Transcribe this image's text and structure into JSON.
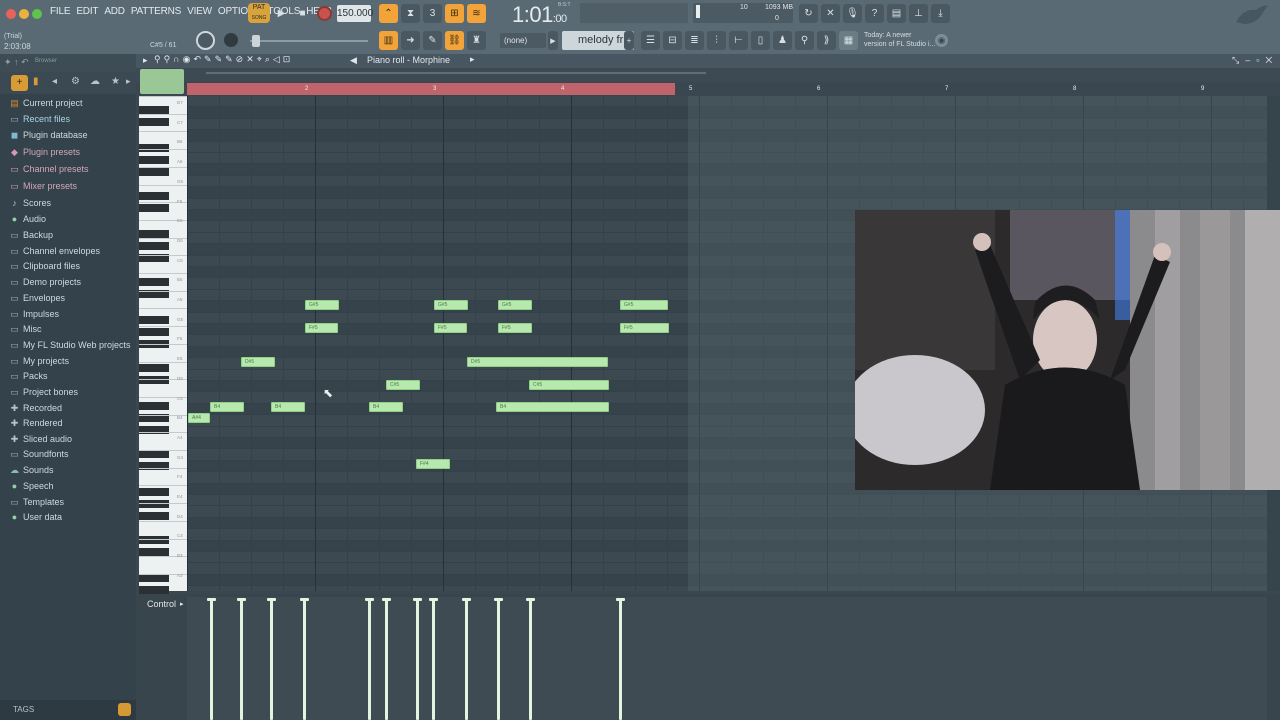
{
  "menu": [
    "FILE",
    "EDIT",
    "ADD",
    "PATTERNS",
    "VIEW",
    "OPTIONS",
    "TOOLS",
    "HELP"
  ],
  "status": {
    "trial": "(Trial)",
    "time_small": "2:03:08",
    "note_hint": "C#5 / 61"
  },
  "transport": {
    "pat_label": "PAT",
    "song_label": "SONG",
    "tempo": "150.000",
    "song_time": "1:01",
    "song_time_ticks": ":00",
    "bst": "B:S:T"
  },
  "monitor": {
    "cpu": "10",
    "memory": "1093 MB",
    "polyphony": "0"
  },
  "news": [
    "Today: A newer",
    "version of FL Studio i..."
  ],
  "pattern": {
    "channel_select": "(none)",
    "pattern_name": "melody fr"
  },
  "browser": {
    "label": "Browser",
    "items": [
      {
        "label": "Current project",
        "icon": "project-icon"
      },
      {
        "label": "Recent files",
        "icon": "folder-icon"
      },
      {
        "label": "Plugin database",
        "icon": "plugin-icon"
      },
      {
        "label": "Plugin presets",
        "icon": "plugin-preset-icon"
      },
      {
        "label": "Channel presets",
        "icon": "channel-preset-icon"
      },
      {
        "label": "Mixer presets",
        "icon": "mixer-preset-icon"
      },
      {
        "label": "Scores",
        "icon": "note-icon"
      },
      {
        "label": "Audio",
        "icon": "person-icon"
      },
      {
        "label": "Backup",
        "icon": "folder-icon"
      },
      {
        "label": "Channel envelopes",
        "icon": "folder-icon"
      },
      {
        "label": "Clipboard files",
        "icon": "folder-icon"
      },
      {
        "label": "Demo projects",
        "icon": "folder-icon"
      },
      {
        "label": "Envelopes",
        "icon": "folder-icon"
      },
      {
        "label": "Impulses",
        "icon": "folder-icon"
      },
      {
        "label": "Misc",
        "icon": "folder-icon"
      },
      {
        "label": "My FL Studio Web projects",
        "icon": "folder-icon"
      },
      {
        "label": "My projects",
        "icon": "folder-icon"
      },
      {
        "label": "Packs",
        "icon": "folder-icon"
      },
      {
        "label": "Project bones",
        "icon": "folder-icon"
      },
      {
        "label": "Recorded",
        "icon": "plus-icon"
      },
      {
        "label": "Rendered",
        "icon": "plus-icon"
      },
      {
        "label": "Sliced audio",
        "icon": "plus-icon"
      },
      {
        "label": "Soundfonts",
        "icon": "folder-icon"
      },
      {
        "label": "Sounds",
        "icon": "cloud-icon"
      },
      {
        "label": "Speech",
        "icon": "person-icon"
      },
      {
        "label": "Templates",
        "icon": "folder-icon"
      },
      {
        "label": "User data",
        "icon": "person-icon"
      }
    ],
    "tags_label": "TAGS"
  },
  "piano_roll": {
    "title": "Piano roll - Morphine",
    "bars": [
      "2",
      "3",
      "4",
      "5",
      "6",
      "7",
      "8",
      "9"
    ],
    "key_labels": [
      "D7",
      "C7",
      "B6",
      "A6",
      "G6",
      "F6",
      "E6",
      "D6",
      "C6",
      "B5",
      "A5",
      "G5",
      "F5",
      "E5",
      "D5",
      "C5",
      "B4",
      "A4",
      "G4",
      "F4",
      "E4",
      "D4",
      "C4",
      "B3",
      "A3"
    ],
    "notes": [
      {
        "label": "G#5"
      },
      {
        "label": "F#5"
      },
      {
        "label": "G#5"
      },
      {
        "label": "F#5"
      },
      {
        "label": "G#5"
      },
      {
        "label": "F#5"
      },
      {
        "label": "G#5"
      },
      {
        "label": "F#5"
      },
      {
        "label": "D#5"
      },
      {
        "label": "D#5"
      },
      {
        "label": "C#5"
      },
      {
        "label": "C#5"
      },
      {
        "label": "B4"
      },
      {
        "label": "B4"
      },
      {
        "label": "B4"
      },
      {
        "label": "B4"
      },
      {
        "label": "A#4"
      },
      {
        "label": "F#4"
      }
    ],
    "control_label": "Control"
  }
}
